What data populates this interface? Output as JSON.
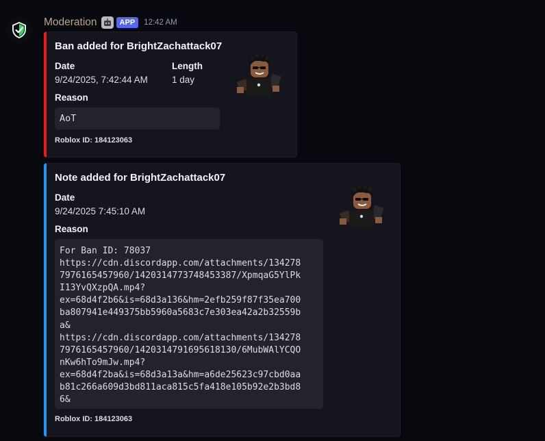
{
  "message": {
    "author": "Moderation",
    "badge": "APP",
    "timestamp": "12:42 AM",
    "avatar_icon": "shield-check-icon",
    "bot_icon": "robot-icon"
  },
  "embeds": [
    {
      "accent": "#ed1c1c",
      "title": "Ban added for BrightZachattack07",
      "fields": [
        {
          "name": "Date",
          "value": "9/24/2025, 7:42:44 AM"
        },
        {
          "name": "Length",
          "value": "1 day"
        },
        {
          "name": "Reason",
          "value": "AoT"
        }
      ],
      "footer": "Roblox ID: 184123063",
      "thumbnail": "roblox-avatar-thumbnail"
    },
    {
      "accent": "#2196f3",
      "title": "Note added for BrightZachattack07",
      "fields": [
        {
          "name": "Date",
          "value": "9/24/2025 7:45:10 AM"
        },
        {
          "name": "Reason",
          "value": "For Ban ID: 78037\nhttps://cdn.discordapp.com/attachments/134278\n7976165457960/1420314773748453387/XpmqaG5YlPk\nI13YvQXzpQA.mp4?\nex=68d4f2b6&is=68d3a136&hm=2efb259f87f35ea700\nba807941e449375bb5960a5683c7e303ea42a2b32559b\na&\nhttps://cdn.discordapp.com/attachments/134278\n7976165457960/1420314791695618130/6MubWAlYCQO\nnKw6hTo9mJw.mp4?\nex=68d4f2ba&is=68d3a13a&hm=a6de25623c97cbd0aa\nb81c266a609d3bd811aca815c5fa418e105b92e2b3bd8\n6&"
        }
      ],
      "footer": "Roblox ID: 184123063",
      "thumbnail": "roblox-avatar-thumbnail"
    }
  ]
}
